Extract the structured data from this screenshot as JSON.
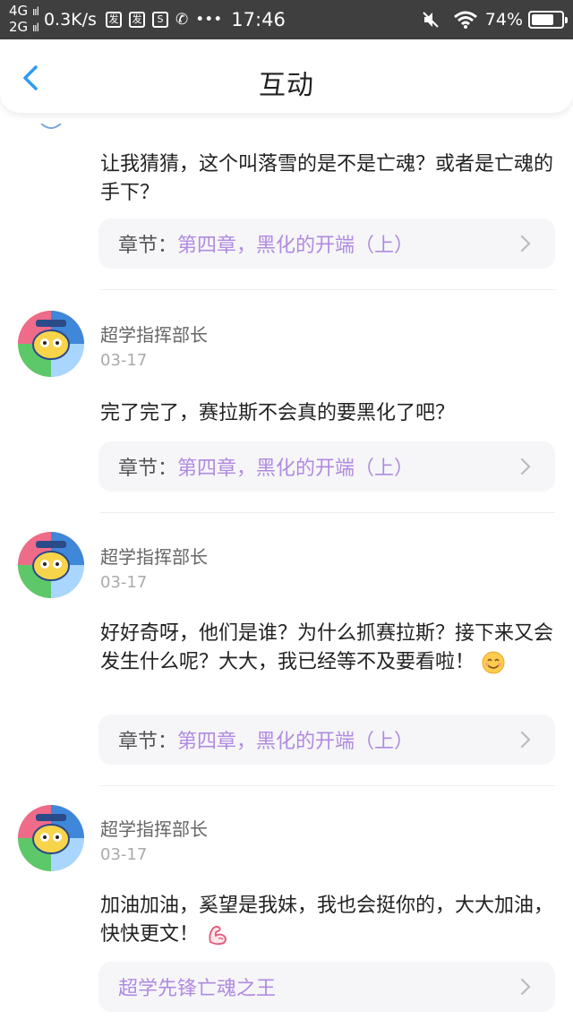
{
  "status_bar": {
    "net1": "4G",
    "net2": "2G",
    "signal_bars": "ııl",
    "speed": "0.3K/s",
    "icon1": "发",
    "icon2": "发",
    "icon3": "S",
    "call": "✆",
    "more": "•••",
    "time": "17:46",
    "battery_text": "74%",
    "battery_level": 0.74
  },
  "header": {
    "title": "互动"
  },
  "comments": [
    {
      "text": "让我猜猜，这个叫落雪的是不是亡魂？或者是亡魂的手下？",
      "chapter_prefix": "章节：",
      "chapter_title": "第四章，黑化的开端（上）"
    },
    {
      "name": "超学指挥部长",
      "date": "03-17",
      "text": "完了完了，赛拉斯不会真的要黑化了吧？",
      "chapter_prefix": "章节：",
      "chapter_title": "第四章，黑化的开端（上）"
    },
    {
      "name": "超学指挥部长",
      "date": "03-17",
      "text": "好好奇呀，他们是谁？为什么抓赛拉斯？接下来又会发生什么呢？大大，我已经等不及要看啦！",
      "emoji": "smile-emoji",
      "chapter_prefix": "章节：",
      "chapter_title": "第四章，黑化的开端（上）"
    },
    {
      "name": "超学指挥部长",
      "date": "03-17",
      "text": "加油加油，奚望是我妹，我也会挺你的，大大加油，快快更文！",
      "emoji": "muscle-emoji",
      "chapter_prefix": "",
      "chapter_title": "超学先锋亡魂之王"
    }
  ],
  "colors": {
    "accent_blue": "#2f9bf0",
    "link_purple": "#b08be0",
    "chip_bg": "#f6f6f8"
  }
}
